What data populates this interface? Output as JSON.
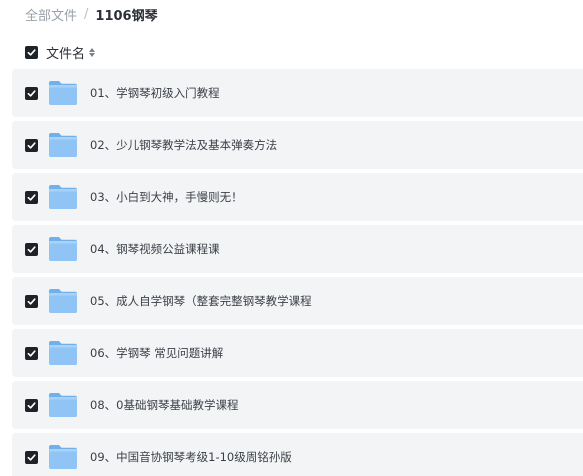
{
  "breadcrumb": {
    "root": "全部文件",
    "separator": "/",
    "current": "1106钢琴"
  },
  "list_header": {
    "column_label": "文件名",
    "select_all_checked": true
  },
  "files": [
    {
      "name": "01、学钢琴初级入门教程",
      "checked": true,
      "icon": "folder-icon"
    },
    {
      "name": "02、少儿钢琴教学法及基本弹奏方法",
      "checked": true,
      "icon": "folder-icon"
    },
    {
      "name": "03、小白到大神，手慢则无！",
      "checked": true,
      "icon": "folder-icon"
    },
    {
      "name": "04、钢琴视频公益课程课",
      "checked": true,
      "icon": "folder-icon"
    },
    {
      "name": "05、成人自学钢琴（整套完整钢琴教学课程",
      "checked": true,
      "icon": "folder-icon"
    },
    {
      "name": "06、学钢琴 常见问题讲解",
      "checked": true,
      "icon": "folder-icon"
    },
    {
      "name": "08、0基础钢琴基础教学课程",
      "checked": true,
      "icon": "folder-icon"
    },
    {
      "name": "09、中国音协钢琴考级1-10级周铭孙版",
      "checked": true,
      "icon": "folder-icon"
    }
  ],
  "colors": {
    "row_background": "#f3f4f6",
    "checkbox_fill": "#1f2329",
    "folder_blue": "#8fc4f5"
  }
}
